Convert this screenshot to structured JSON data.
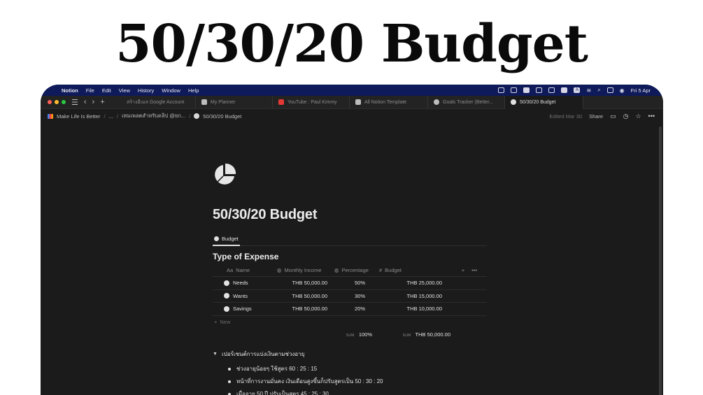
{
  "headline": "50/30/20 Budget",
  "menubar": {
    "items": [
      "Notion",
      "File",
      "Edit",
      "View",
      "History",
      "Window",
      "Help"
    ],
    "tray_letter": "A",
    "datetime": "Fri 5 Apr"
  },
  "tabs": [
    {
      "label": "สร้างอีเมล Google Account",
      "icon_color": "#5b8def",
      "active": false
    },
    {
      "label": "My Planner",
      "icon_color": "#bdbdbd",
      "active": false
    },
    {
      "label": "YouTube : Paul Kimmy",
      "icon_color": "#e53935",
      "active": false
    },
    {
      "label": "All Notion Template",
      "icon_color": "#bdbdbd",
      "active": false
    },
    {
      "label": "Goals Tracker (Better...",
      "icon_color": "#bdbdbd",
      "active": false
    },
    {
      "label": "50/30/20 Budget",
      "icon_color": "#e0e0e0",
      "active": true
    }
  ],
  "breadcrumb": {
    "items": [
      "Make Life Is Better",
      "...",
      "เทมเพลตสำหรับคลิป @ยก...",
      "50/30/20 Budget"
    ],
    "separator": "/"
  },
  "topbar": {
    "edited": "Edited Mar 30",
    "share": "Share"
  },
  "page": {
    "title": "50/30/20 Budget",
    "view_tab": "Budget",
    "db_title": "Type of Expense",
    "columns": {
      "name": "Name",
      "name_prefix": "Aa",
      "income": "Monthly Income",
      "percentage": "Percentage",
      "budget": "Budget",
      "budget_prefix": "#"
    },
    "rows": [
      {
        "name": "Needs",
        "income": "THB 50,000.00",
        "percentage": "50%",
        "budget": "THB 25,000.00"
      },
      {
        "name": "Wants",
        "income": "THB 50,000.00",
        "percentage": "30%",
        "budget": "THB 15,000.00"
      },
      {
        "name": "Savings",
        "income": "THB 50,000.00",
        "percentage": "20%",
        "budget": "THB 10,000.00"
      }
    ],
    "new_label": "New",
    "sum": {
      "label": "SUM",
      "percentage": "100%",
      "budget": "THB 50,000.00"
    },
    "toggle_heading": "เปอร์เซนต์การแบ่งเงินตามช่วงอายุ",
    "bullets": [
      "ช่วงอายุน้อยๆ ใช้สูตร 60 : 25 : 15",
      "หน้าที่การงานมั่นคง เงินเดือนสูงขึ้นก็ปรับสูตรเป็น 50 : 30 : 20",
      "เมื่ออายุ 50 ปี ปรับเป็นสูตร 45 : 25 : 30"
    ]
  },
  "colors": {
    "background": "#1b1b1b",
    "menubar": "#0e1a5a",
    "text": "#e6e6e6"
  }
}
